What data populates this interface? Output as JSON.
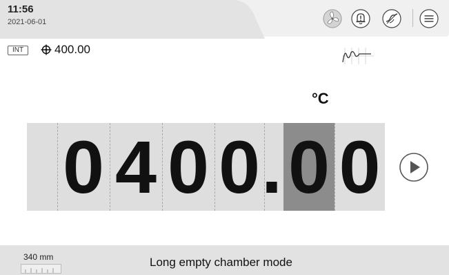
{
  "header": {
    "time": "11:56",
    "date": "2021-06-01",
    "icons": [
      "fan-icon",
      "alarm-bell-icon",
      "curve-icon",
      "menu-icon"
    ]
  },
  "info": {
    "mode_badge": "INT",
    "setpoint": "400.00",
    "trend_icon": "trend-chart-icon"
  },
  "display": {
    "unit": "°C",
    "digits": [
      "0",
      "4",
      "0",
      "0",
      ".",
      "0",
      "0"
    ],
    "selected_digit": 5
  },
  "footer": {
    "size": "340 mm",
    "mode": "Long empty chamber mode"
  },
  "colors": {
    "header_tab": "#e6e6e6",
    "panel": "#dedede",
    "selected": "#8c8c8c",
    "footer": "#e2e2e2"
  }
}
